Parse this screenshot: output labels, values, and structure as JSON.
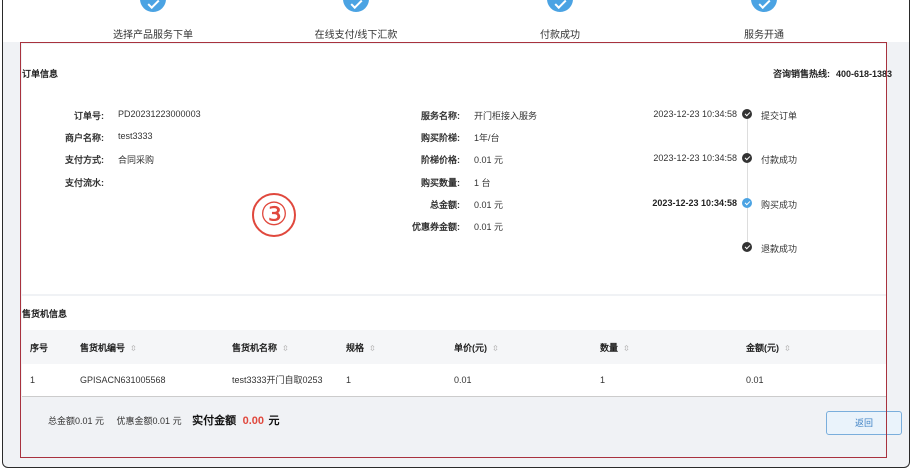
{
  "steps": [
    "选择产品服务下单",
    "在线支付/线下汇款",
    "付款成功",
    "服务开通"
  ],
  "order": {
    "title": "订单信息",
    "hotline_label": "咨询销售热线:",
    "hotline_number": "400-618-1383",
    "left": [
      {
        "label": "订单号:",
        "value": "PD20231223000003"
      },
      {
        "label": "商户名称:",
        "value": "test3333"
      },
      {
        "label": "支付方式:",
        "value": "合同采购"
      },
      {
        "label": "支付流水:",
        "value": ""
      }
    ],
    "middle": [
      {
        "label": "服务名称:",
        "value": "开门柜接入服务"
      },
      {
        "label": "购买阶梯:",
        "value": "1年/台"
      },
      {
        "label": "阶梯价格:",
        "value": "0.01 元"
      },
      {
        "label": "购买数量:",
        "value": "1  台"
      },
      {
        "label": "总金额:",
        "value": "0.01 元"
      },
      {
        "label": "优惠券金额:",
        "value": "0.01 元"
      }
    ],
    "timeline": [
      {
        "time": "2023-12-23 10:34:58",
        "text": "提交订单"
      },
      {
        "time": "2023-12-23 10:34:58",
        "text": "付款成功"
      },
      {
        "time": "2023-12-23 10:34:58",
        "text": "购买成功"
      },
      {
        "time": "",
        "text": "退款成功"
      }
    ]
  },
  "annotation": "③",
  "vending": {
    "title": "售货机信息",
    "columns": [
      "序号",
      "售货机编号",
      "售货机名称",
      "规格",
      "单价(元)",
      "数量",
      "金额(元)"
    ],
    "rows": [
      [
        "1",
        "GPISACN631005568",
        "test3333开门自取0253",
        "1",
        "0.01",
        "1",
        "0.01"
      ]
    ]
  },
  "footer": {
    "total": "总金额0.01 元",
    "discount": "优惠金额0.01 元",
    "paid_label": "实付金额",
    "paid_value": "0.00",
    "paid_unit": "元",
    "back_label": "返回"
  },
  "colors": {
    "accent": "#4ba3e3",
    "danger": "#e0483d"
  }
}
